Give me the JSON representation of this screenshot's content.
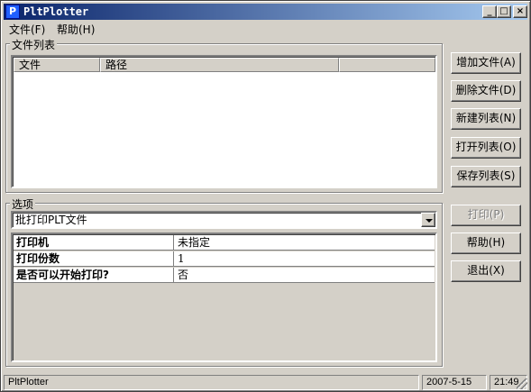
{
  "window": {
    "title": "PltPlotter",
    "icon": "P",
    "minimize": "_",
    "maximize": "□",
    "close": "×"
  },
  "menu": {
    "file": "文件(F)",
    "help": "帮助(H)"
  },
  "file_group": {
    "label": "文件列表",
    "columns": [
      "文件",
      "路径"
    ],
    "buttons": {
      "add": "增加文件(A)",
      "delete": "删除文件(D)",
      "new_list": "新建列表(N)",
      "open_list": "打开列表(O)",
      "save_list": "保存列表(S)"
    }
  },
  "options_group": {
    "label": "选项",
    "mode_select": "批打印PLT文件",
    "properties": [
      {
        "name": "打印机",
        "value": "未指定"
      },
      {
        "name": "打印份数",
        "value": "1"
      },
      {
        "name": "是否可以开始打印?",
        "value": "否"
      }
    ]
  },
  "actions": {
    "print": "打印(P)",
    "help": "帮助(H)",
    "exit": "退出(X)"
  },
  "statusbar": {
    "app": "PltPlotter",
    "date": "2007-5-15",
    "time": "21:49"
  }
}
